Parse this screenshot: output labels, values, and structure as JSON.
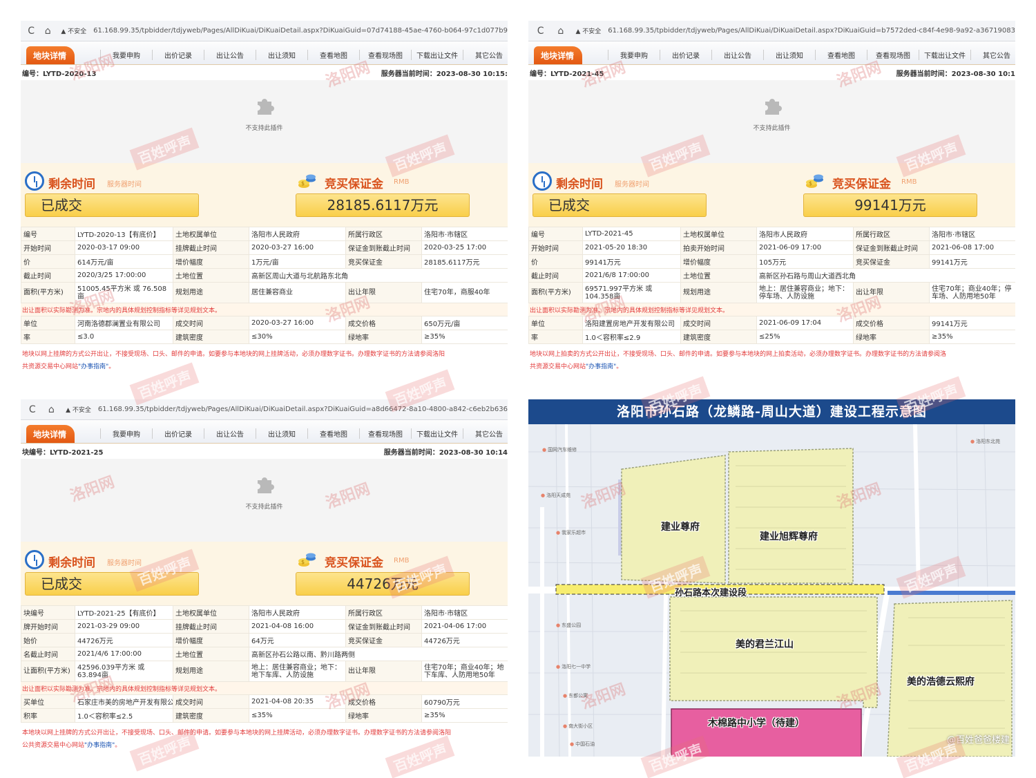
{
  "panels": [
    {
      "back": "C",
      "home": "⌂",
      "warn": "▲ 不安全",
      "url": "61.168.99.35/tpbidder/tdjyweb/Pages/AllDiKuai/DiKuaiDetail.aspx?DiKuaiGuid=07d74188-45ae-4760-b064-97c1d077b9",
      "tab": "地块详情",
      "nav": [
        "我要申购",
        "出价记录",
        "出让公告",
        "出让须知",
        "查看地图",
        "查看现场图",
        "下载出让文件",
        "其它公告"
      ],
      "code_label": "编号：LYTD-2020-13",
      "server_time": "服务器当前时间：2023-08-30 10:15:",
      "plugin": "不支持此插件",
      "remaining_title": "剩余时间",
      "remaining_sub": "服务器时间",
      "remaining_value": "已成交",
      "deposit_title": "竞买保证金",
      "deposit_sub": "RMB",
      "deposit_value": "28185.6117万元",
      "rows": [
        [
          "编号",
          "LYTD-2020-13【有底价】",
          "土地权属单位",
          "洛阳市人民政府",
          "所属行政区",
          "洛阳市·市辖区"
        ],
        [
          "开始时间",
          "2020-03-17 09:00",
          "挂牌截止时间",
          "2020-03-27 16:00",
          "保证金到账截止时间",
          "2020-03-25 17:00"
        ],
        [
          "价",
          "614万元/亩",
          "增价幅度",
          "1万元/亩",
          "竞买保证金",
          "28185.6117万元"
        ],
        [
          "截止时间",
          "2020/3/25 17:00:00",
          "土地位置",
          "高新区周山大道与北航路东北角",
          "",
          ""
        ],
        [
          "面积(平方米)",
          "51005.45平方米 或 76.508亩",
          "规划用途",
          "居住兼容商业",
          "出让年限",
          "住宅70年，商服40年"
        ]
      ],
      "note": "出让面积以实际勘测为准。宗地内的具体规划控制指标等详见规划文本。",
      "rows2": [
        [
          "单位",
          "河南洛德郡澜置业有限公司",
          "成交时间",
          "2020-03-27 16:00",
          "成交价格",
          "650万元/亩"
        ],
        [
          "率",
          "≤3.0",
          "建筑密度",
          "≤30%",
          "绿地率",
          "≥35%"
        ]
      ],
      "disc1": "地块以网上挂牌的方式公开出让，不接受现场、口头、邮件的申请。如要参与本地块的网上挂牌活动，必须办理数字证书。办理数字证书的方法请参阅洛阳",
      "disc2": "共资源交易中心网站",
      "disc_link": "\"办事指南\"",
      "disc_end": "。"
    },
    {
      "back": "C",
      "home": "⌂",
      "warn": "▲ 不安全",
      "url": "61.168.99.35/tpbidder/tdjyweb/Pages/AllDiKuai/DiKuaiDetail.aspx?DiKuaiGuid=b7572ded-c84f-4e98-9a92-a36719083",
      "tab": "地块详情",
      "nav": [
        "我要申购",
        "出价记录",
        "出让公告",
        "出让须知",
        "查看地图",
        "查看现场图",
        "下载出让文件",
        "其它公告"
      ],
      "code_label": "编号：LYTD-2021-45",
      "server_time": "服务器当前时间：2023-08-30 10:1",
      "plugin": "不支持此插件",
      "remaining_title": "剩余时间",
      "remaining_sub": "服务器时间",
      "remaining_value": "已成交",
      "deposit_title": "竞买保证金",
      "deposit_sub": "RMB",
      "deposit_value": "99141万元",
      "rows": [
        [
          "编号",
          "LYTD-2021-45",
          "土地权属单位",
          "洛阳市人民政府",
          "所属行政区",
          "洛阳市·市辖区"
        ],
        [
          "开始时间",
          "2021-05-20 18:30",
          "拍卖开始时间",
          "2021-06-09 17:00",
          "保证金到账截止时间",
          "2021-06-08 17:00"
        ],
        [
          "价",
          "99141万元",
          "增价幅度",
          "105万元",
          "竞买保证金",
          "99141万元"
        ],
        [
          "截止时间",
          "2021/6/8 17:00:00",
          "土地位置",
          "高新区孙石路与周山大道西北角",
          "",
          ""
        ],
        [
          "面积(平方米)",
          "69571.997平方米 或 104.358亩",
          "规划用途",
          "地上：居住兼容商业；地下：停车场、人防设施",
          "出让年限",
          "住宅70年；商业40年；停车场、人防用地50年"
        ]
      ],
      "note": "出让面积以实际勘测为准。宗地内的具体规划控制指标等详见规划文本。",
      "rows2": [
        [
          "单位",
          "洛阳建置房地产开发有限公司",
          "成交时间",
          "2021-06-09 17:04",
          "成交价格",
          "99141万元"
        ],
        [
          "率",
          "1.0＜容积率≤2.9",
          "建筑密度",
          "≤25%",
          "绿地率",
          "≥35%"
        ]
      ],
      "disc1": "地块以网上拍卖的方式公开出让，不接受现场、口头、邮件的申请。如要参与本地块的网上拍卖活动，必须办理数字证书。办理数字证书的方法请参阅洛",
      "disc2": "共资源交易中心网站",
      "disc_link": "\"办事指南\"",
      "disc_end": "。"
    },
    {
      "back": "C",
      "home": "⌂",
      "warn": "▲ 不安全",
      "url": "61.168.99.35/tpbidder/tdjyweb/Pages/AllDiKuai/DiKuaiDetail.aspx?DiKuaiGuid=a8d66472-8a10-4800-a842-c6eb2b636",
      "tab": "地块详情",
      "nav": [
        "我要申购",
        "出价记录",
        "出让公告",
        "出让须知",
        "查看地图",
        "查看现场图",
        "下载出让文件",
        "其它公告"
      ],
      "code_label": "块编号：LYTD-2021-25",
      "server_time": "服务器当前时间：2023-08-30 10:14",
      "plugin": "不支持此插件",
      "remaining_title": "剩余时间",
      "remaining_sub": "服务器时间",
      "remaining_value": "已成交",
      "deposit_title": "竞买保证金",
      "deposit_sub": "RMB",
      "deposit_value": "44726万元",
      "rows": [
        [
          "块编号",
          "LYTD-2021-25【有底价】",
          "土地权属单位",
          "洛阳市人民政府",
          "所属行政区",
          "洛阳市·市辖区"
        ],
        [
          "牌开始时间",
          "2021-03-29 09:00",
          "挂牌截止时间",
          "2021-04-08 16:00",
          "保证金到账截止时间",
          "2021-04-06 17:00"
        ],
        [
          "始价",
          "44726万元",
          "增价幅度",
          "64万元",
          "竞买保证金",
          "44726万元"
        ],
        [
          "名截止时间",
          "2021/4/6 17:00:00",
          "土地位置",
          "高新区孙石公路以南、黔川路两侧",
          "",
          ""
        ],
        [
          "让面积(平方米)",
          "42596.039平方米 或 63.894亩",
          "规划用途",
          "地上：居住兼容商业；地下：地下车库、人防设施",
          "出让年限",
          "住宅70年；商业40年；地下车库、人防用地50年"
        ]
      ],
      "note": "出让面积以实际勘测为准。宗地内的具体规划控制指标等详见规划文本。",
      "rows2": [
        [
          "买单位",
          "石家庄市美的房地产开发有限公司",
          "成交时间",
          "2021-04-08 20:35",
          "成交价格",
          "60790万元"
        ],
        [
          "积率",
          "1.0＜容积率≤2.5",
          "建筑密度",
          "≤35%",
          "绿地率",
          "≥35%"
        ]
      ],
      "disc1": "本地块以网上挂牌的方式公开出让，不接受现场、口头、邮件的申请。如要参与本地块的网上挂牌活动，必须办理数字证书。办理数字证书的方法请参阅洛阳",
      "disc2": "公共资源交易中心网站",
      "disc_link": "\"办事指南\"",
      "disc_end": "。"
    }
  ],
  "map": {
    "title": "洛阳市孙石路（龙鳞路-周山大道）建设工程示意图",
    "labels": {
      "a": "建业尊府",
      "b": "建业旭辉尊府",
      "road": "孙石路本次建设段",
      "c": "美的君兰江山",
      "d": "美的浩德云熙府",
      "e": "木棉路中小学（待建）"
    },
    "pois": [
      "我家乐超市",
      "国网汽车维修",
      "洛阳天成苑",
      "东盛公园",
      "中国石油",
      "洛阳七一中学",
      "东都公寓",
      "南大街小区",
      "洛阳东北苑"
    ],
    "mark": "@百姓爸爸楼建"
  },
  "watermark": {
    "a": "洛阳网",
    "b": "百姓呼声"
  }
}
